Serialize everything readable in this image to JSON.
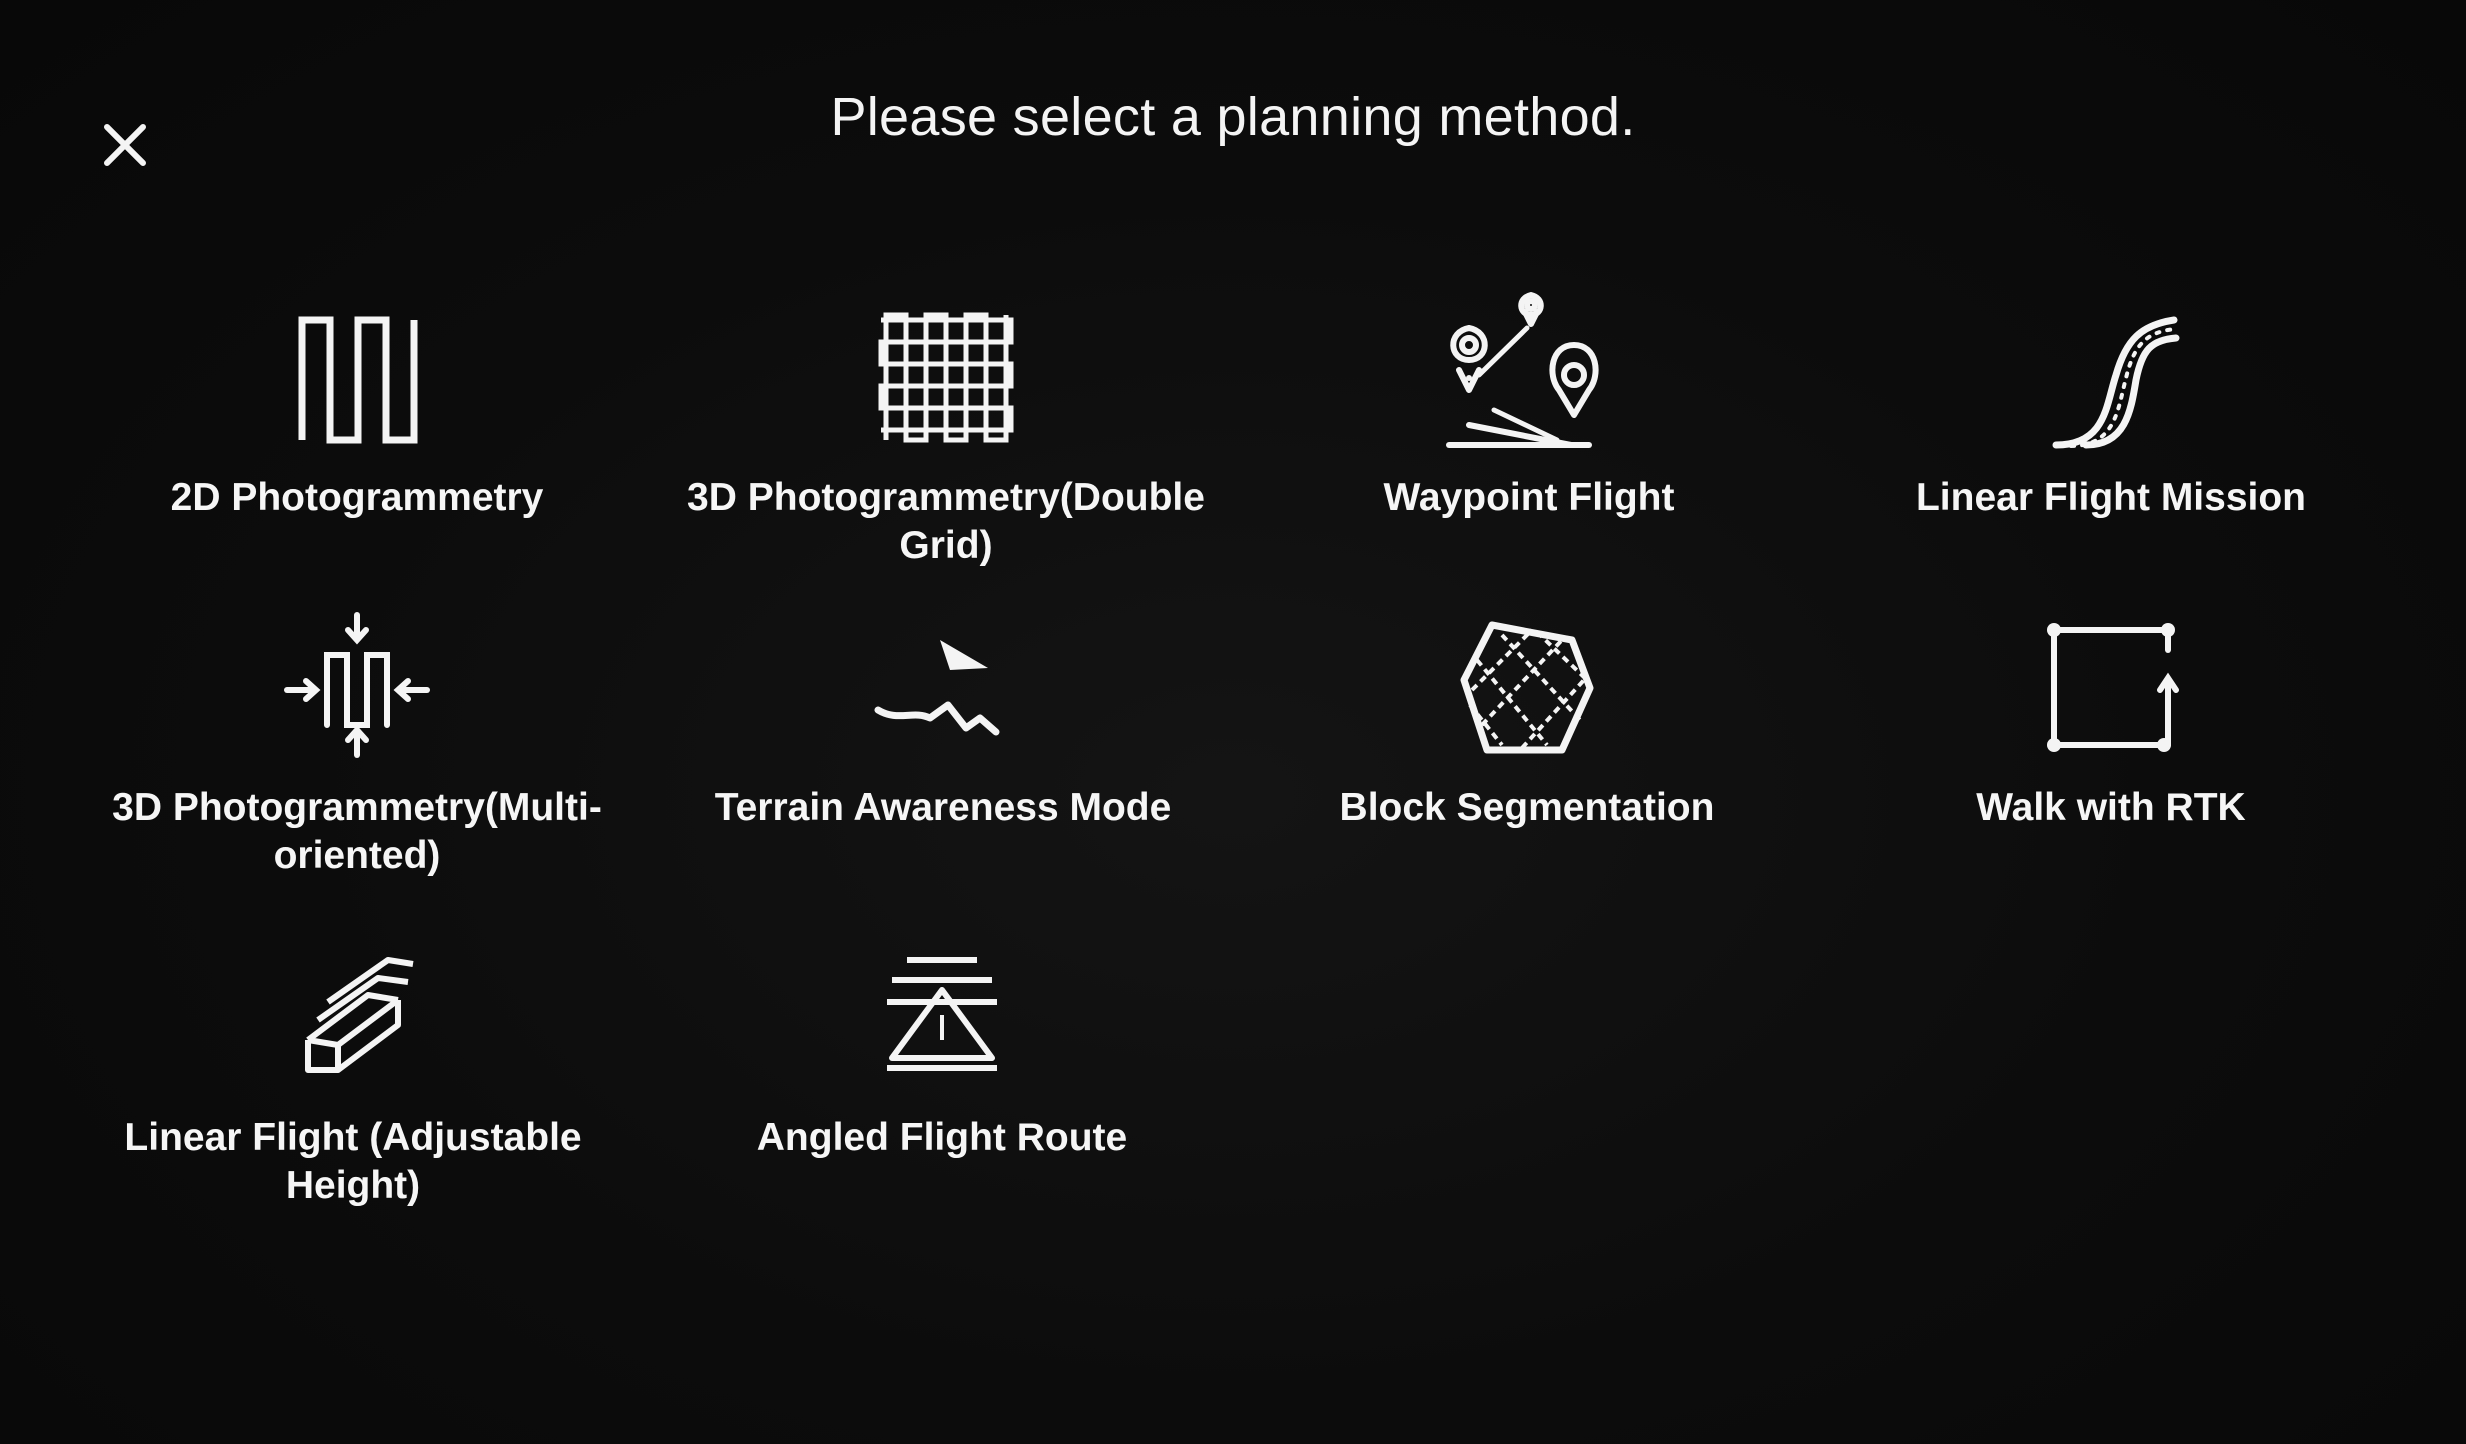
{
  "header": {
    "title": "Please select a planning method.",
    "close_icon": "close-icon"
  },
  "methods": [
    {
      "label": "2D Photogrammetry",
      "icon": "zigzag-route-icon"
    },
    {
      "label": "3D Photogrammetry(Double Grid)",
      "icon": "double-grid-icon"
    },
    {
      "label": "Waypoint Flight",
      "icon": "waypoint-pins-icon"
    },
    {
      "label": "Linear Flight Mission",
      "icon": "curved-route-icon"
    },
    {
      "label": "3D Photogrammetry(Multi-oriented)",
      "icon": "multi-oriented-route-icon"
    },
    {
      "label": "Terrain Awareness Mode",
      "icon": "terrain-follow-icon"
    },
    {
      "label": "Block Segmentation",
      "icon": "block-segment-icon"
    },
    {
      "label": "Walk with RTK",
      "icon": "rtk-walk-icon"
    },
    {
      "label": "Linear Flight (Adjustable Height)",
      "icon": "stacked-linear-icon"
    },
    {
      "label": "Angled Flight Route",
      "icon": "angled-route-icon"
    }
  ],
  "colors": {
    "background": "#0b0b0b",
    "foreground": "#f4f4f4"
  }
}
